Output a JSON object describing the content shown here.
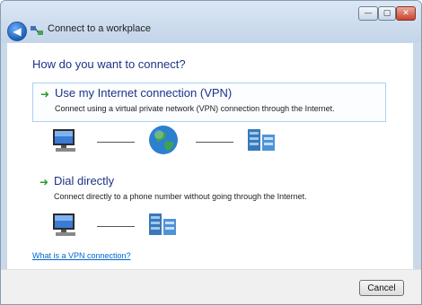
{
  "window": {
    "title": "Connect to a workplace"
  },
  "controls": {
    "minimize": "—",
    "maximize": "▢",
    "close": "✕"
  },
  "heading": "How do you want to connect?",
  "options": [
    {
      "title": "Use my Internet connection (VPN)",
      "description": "Connect using a virtual private network (VPN) connection through the Internet."
    },
    {
      "title": "Dial directly",
      "description": "Connect directly to a phone number without going through the Internet."
    }
  ],
  "help_link": "What is a VPN connection?",
  "buttons": {
    "cancel": "Cancel"
  },
  "colors": {
    "heading": "#1e3287",
    "link": "#0066cc",
    "arrow": "#2f9a2f",
    "accent_border": "#a9d1f5"
  },
  "icons": {
    "back": "back-arrow-icon",
    "app": "network-icon",
    "computer": "computer-icon",
    "internet": "globe-icon",
    "workplace": "server-icon",
    "option_arrow": "green-arrow-icon"
  }
}
